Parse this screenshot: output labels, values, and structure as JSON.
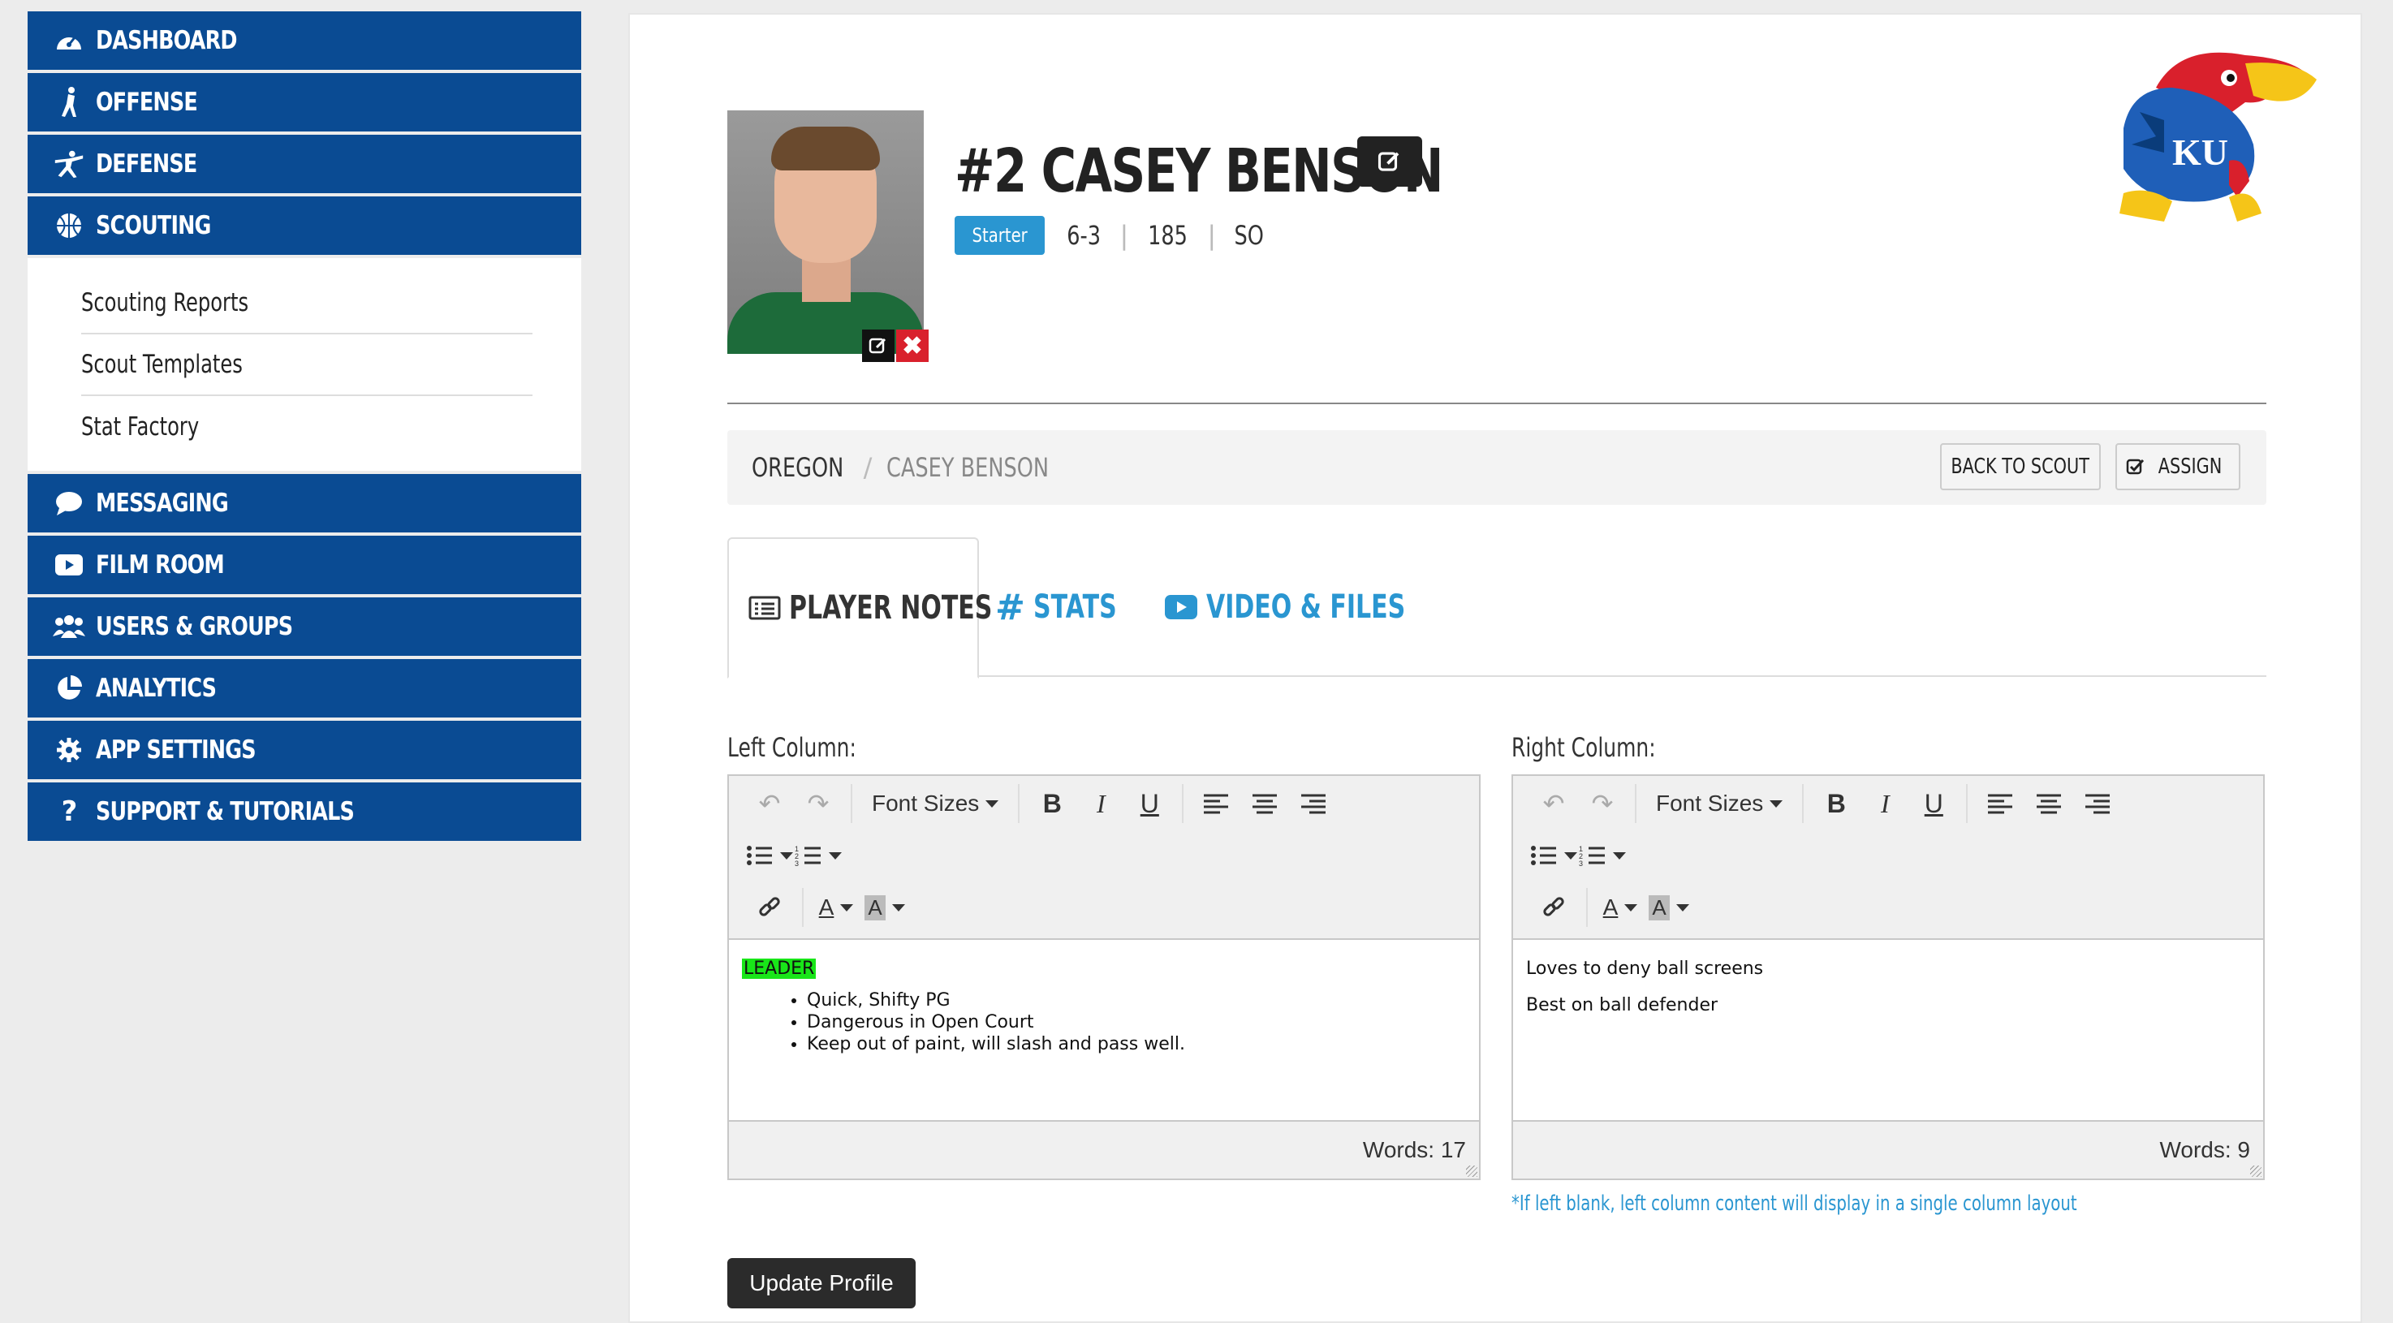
{
  "sidebar": {
    "items": [
      {
        "label": "DASHBOARD",
        "icon": "dashboard-gauge-icon"
      },
      {
        "label": "OFFENSE",
        "icon": "offense-player-icon"
      },
      {
        "label": "DEFENSE",
        "icon": "defense-player-icon"
      },
      {
        "label": "SCOUTING",
        "icon": "basketball-icon"
      }
    ],
    "scouting_sub": [
      {
        "label": "Scouting Reports"
      },
      {
        "label": "Scout Templates"
      },
      {
        "label": "Stat Factory"
      }
    ],
    "items_after": [
      {
        "label": "MESSAGING",
        "icon": "chat-bubble-icon"
      },
      {
        "label": "FILM ROOM",
        "icon": "play-icon"
      },
      {
        "label": "USERS & GROUPS",
        "icon": "users-icon"
      },
      {
        "label": "ANALYTICS",
        "icon": "pie-chart-icon"
      },
      {
        "label": "APP SETTINGS",
        "icon": "gear-icon"
      },
      {
        "label": "SUPPORT & TUTORIALS",
        "icon": "question-icon"
      }
    ]
  },
  "player": {
    "name": "#2 CASEY BENSON",
    "status": "Starter",
    "height": "6-3",
    "weight": "185",
    "year": "SO"
  },
  "breadcrumb": {
    "team": "OREGON",
    "player": "CASEY BENSON"
  },
  "buttons": {
    "back": "BACK TO SCOUT",
    "assign": "ASSIGN",
    "update": "Update Profile"
  },
  "tabs": {
    "notes": "PLAYER NOTES",
    "stats": "STATS",
    "video": "VIDEO & FILES"
  },
  "editor": {
    "font_sizes": "Font Sizes",
    "left_label": "Left Column:",
    "right_label": "Right Column:",
    "left_highlight": "LEADER",
    "left_bullets": [
      "Quick, Shifty PG",
      "Dangerous in Open Court",
      "Keep out of paint, will slash and pass well."
    ],
    "right_lines": [
      "Loves to deny ball screens",
      "Best on ball defender"
    ],
    "left_words": "Words: 17",
    "right_words": "Words: 9"
  },
  "note": "*If left blank, left column content will display in a single column layout",
  "colors": {
    "nav": "#0a4b93",
    "accent": "#2a96d1",
    "highlight": "#19e619",
    "delete": "#d9202c"
  }
}
